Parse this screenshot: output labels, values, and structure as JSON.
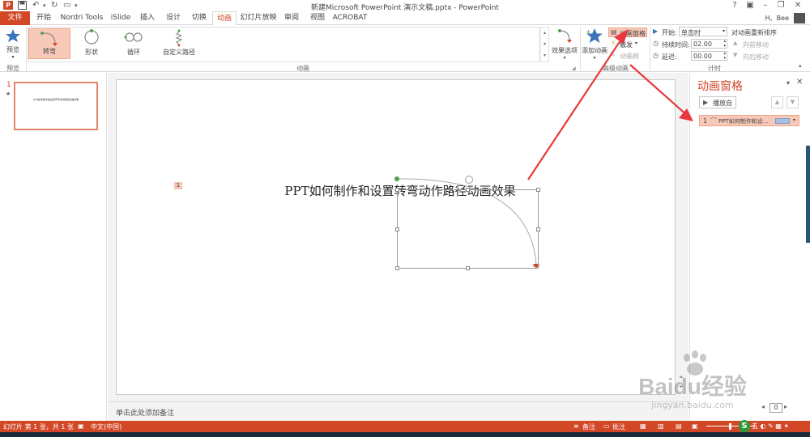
{
  "window": {
    "title": "新建Microsoft PowerPoint 演示文稿.pptx - PowerPoint",
    "help": "?",
    "user": "H、Bee"
  },
  "tabs": [
    {
      "label": "文件"
    },
    {
      "label": "开始"
    },
    {
      "label": "Nordri Tools"
    },
    {
      "label": "iSlide"
    },
    {
      "label": "插入"
    },
    {
      "label": "设计"
    },
    {
      "label": "切换"
    },
    {
      "label": "动画"
    },
    {
      "label": "幻灯片放映"
    },
    {
      "label": "审阅"
    },
    {
      "label": "视图"
    },
    {
      "label": "ACROBAT"
    }
  ],
  "ribbon": {
    "preview": {
      "button": "预览",
      "group": "预览"
    },
    "animation_gallery": {
      "items": [
        {
          "label": "转弯",
          "selected": true
        },
        {
          "label": "形状",
          "selected": false
        },
        {
          "label": "循环",
          "selected": false
        },
        {
          "label": "自定义路径",
          "selected": false
        }
      ],
      "effect_options": "效果选项",
      "group": "动画"
    },
    "advanced": {
      "add_animation": "添加动画",
      "animation_pane": "动画窗格",
      "trigger": "触发",
      "animation_painter": "动画刷",
      "group": "高级动画"
    },
    "timing": {
      "start_label": "开始:",
      "start_value": "单击时",
      "duration_label": "持续时间:",
      "duration_value": "02.00",
      "delay_label": "延迟:",
      "delay_value": "00.00",
      "reorder_title": "对动画重新排序",
      "move_earlier": "向前移动",
      "move_later": "向后移动",
      "group": "计时"
    }
  },
  "thumbnails": [
    {
      "number": "1",
      "star": "★",
      "text": "PPT如何制作和设置转弯动作路径动画效果"
    }
  ],
  "slide": {
    "text": "PPT如何制作和设置转弯动作路径动画效果",
    "animation_tag": "1",
    "notes_placeholder": "单击此处添加备注"
  },
  "animation_pane": {
    "title": "动画窗格",
    "play_button": "播放自",
    "items": [
      {
        "index": "1",
        "label": "PPT如何制作和设..."
      }
    ]
  },
  "statusbar": {
    "slide_info": "幻灯片 第 1 张，共 1 张",
    "language": "中文(中国)",
    "notes": "备注",
    "comments": "批注",
    "zoom_value": "0"
  },
  "watermark": {
    "brand": "Baidu经验",
    "url": "jingyan.baidu.com"
  },
  "colors": {
    "accent": "#d24726",
    "selection": "#f8c9b8",
    "arrow": "#e8383d"
  }
}
